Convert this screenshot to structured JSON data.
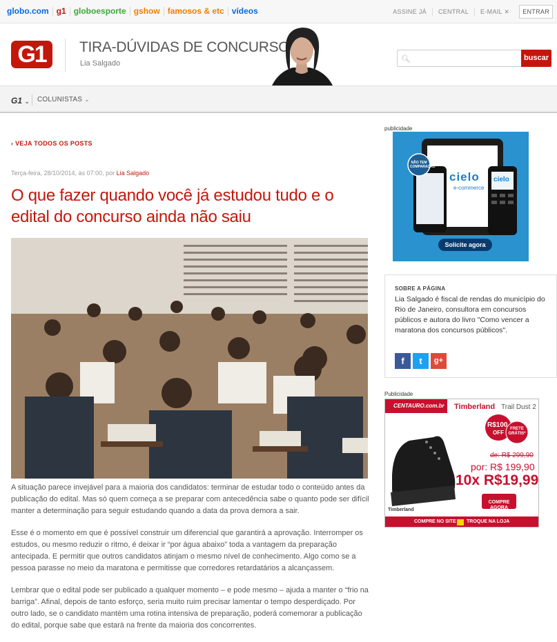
{
  "topbar": {
    "links": [
      {
        "label": "globo.com",
        "color": "#0669de"
      },
      {
        "label": "g1",
        "color": "#c4170c"
      },
      {
        "label": "globoesporte",
        "color": "#39a935"
      },
      {
        "label": "gshow",
        "color": "#f27e00"
      },
      {
        "label": "famosos & etc",
        "color": "#f27e00"
      },
      {
        "label": "vídeos",
        "color": "#0669de"
      }
    ],
    "right": [
      "ASSINE JÁ",
      "CENTRAL",
      "E-MAIL"
    ],
    "login": "ENTRAR"
  },
  "header": {
    "logo": "G1",
    "blog_title": "TIRA-DÚVIDAS DE CONCURSOS",
    "author": "Lia Salgado",
    "search_placeholder": "",
    "search_button": "buscar"
  },
  "nav": {
    "g1": "G1",
    "colunistas": "COLUNISTAS"
  },
  "post": {
    "back_link": "VEJA TODOS OS POSTS",
    "date": "Terça-feira, 28/10/2014, às 07:00, por",
    "author": "Lia Salgado",
    "headline": "O que fazer quando você já estudou tudo e o edital do concurso ainda não saiu",
    "paragraphs": [
      "A situação parece invejável para a maioria dos candidatos: terminar de estudar todo o conteúdo antes da publicação do edital. Mas só quem começa a se preparar com antecedência sabe o quanto pode ser difícil manter a determinação para seguir estudando quando a data da prova demora a sair.",
      "Esse é o momento em que é possível construir um diferencial que garantirá a aprovação. Interromper os estudos, ou mesmo reduzir o ritmo, é deixar ir “por água abaixo” toda a vantagem da preparação antecipada. E permitir que outros candidatos atinjam o mesmo nível de conhecimento. Algo como se a pessoa parasse no meio da maratona e permitisse que corredores retardatários a alcançassem.",
      "Lembrar que o edital pode ser publicado a qualquer momento – e pode mesmo – ajuda a manter o “frio na barriga”. Afinal, depois de tanto esforço, seria muito ruim precisar lamentar o tempo desperdiçado. Por outro lado, se o candidato mantém uma rotina intensiva de preparação, poderá comemorar a publicação do edital, porque sabe que estará na frente da maioria dos concorrentes."
    ]
  },
  "sidebar": {
    "ad_label": "publicidade",
    "ad1": {
      "brand": "cielo",
      "sub": "e-commerce",
      "badge": "NÃO TEM COMPARAÇÃO",
      "cta": "Solicite agora"
    },
    "about": {
      "title": "SOBRE A PÁGINA",
      "text": "Lia Salgado é fiscal de rendas do município do Rio de Janeiro, consultora em concursos públicos e autora do livro \"Como vencer a maratona dos concursos públicos\".",
      "social": [
        "f",
        "t",
        "g+"
      ]
    },
    "ad_label2": "Publicidade",
    "ad2": {
      "store": "CENTAURO.com.br",
      "product": "Timberland",
      "model": "Trail Dust 2",
      "discount_top": "R$100",
      "discount_bottom": "OFF",
      "frete": "FRETE GRÁTIS*",
      "old_price": "de: R$ 299,90",
      "new_price": "por: R$ 199,90",
      "installments": "10x R$19,99",
      "cta": "COMPRE AGORA",
      "logo": "Timberland",
      "footer_left": "COMPRE NO SITE",
      "footer_right": "TROQUE NA LOJA"
    }
  }
}
